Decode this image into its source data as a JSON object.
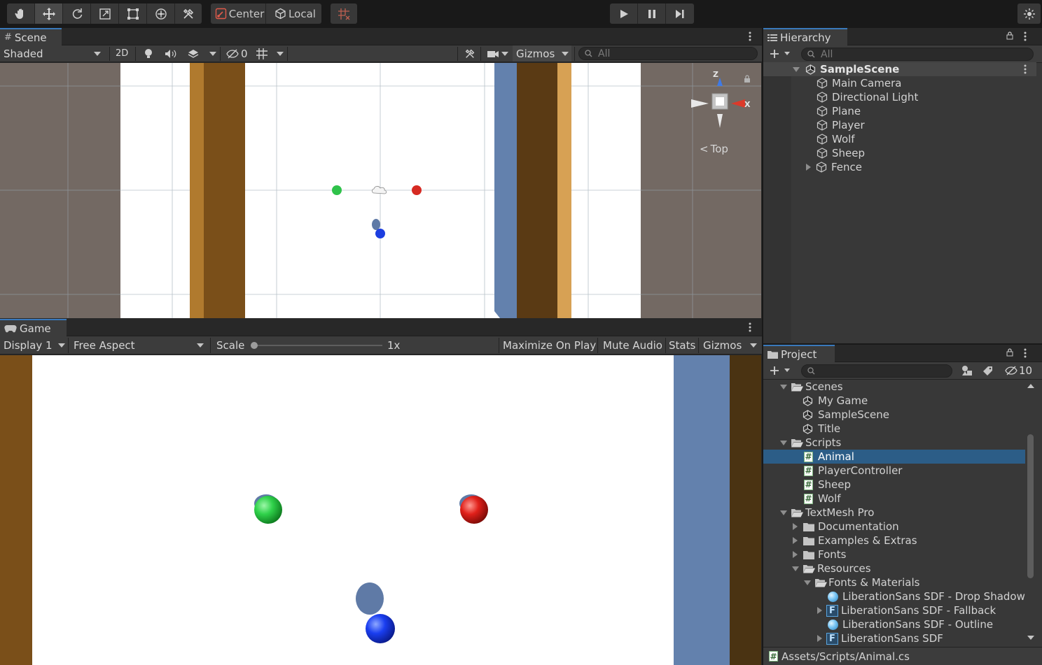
{
  "toolbar": {
    "tools": [
      "hand-tool",
      "move-tool",
      "rotate-tool",
      "scale-tool",
      "rect-tool",
      "transform-tool",
      "custom-tool"
    ],
    "pivot_label": "Center",
    "space_label": "Local"
  },
  "scene": {
    "tab_label": "Scene",
    "shading_mode": "Shaded",
    "toggle_2d": "2D",
    "hidden_count": "0",
    "gizmos_label": "Gizmos",
    "search_placeholder": "All",
    "gizmo_view_label": "Top",
    "axis_z": "Z",
    "axis_x": "X"
  },
  "game": {
    "tab_label": "Game",
    "display": "Display 1",
    "aspect": "Free Aspect",
    "scale_label": "Scale",
    "scale_value": "1x",
    "scale_fraction": 0.0,
    "maximize_label": "Maximize On Play",
    "mute_label": "Mute Audio",
    "stats_label": "Stats",
    "gizmos_label": "Gizmos"
  },
  "hierarchy": {
    "tab_label": "Hierarchy",
    "search_placeholder": "All",
    "scene_name": "SampleScene",
    "objects": [
      "Main Camera",
      "Directional Light",
      "Plane",
      "Player",
      "Wolf",
      "Sheep",
      "Fence"
    ]
  },
  "project": {
    "tab_label": "Project",
    "hidden_packages_count": "10",
    "search_placeholder": "",
    "tree": [
      {
        "label": "Scenes",
        "kind": "folder-open"
      },
      {
        "label": "My Game",
        "kind": "scene"
      },
      {
        "label": "SampleScene",
        "kind": "scene"
      },
      {
        "label": "Title",
        "kind": "scene"
      },
      {
        "label": "Scripts",
        "kind": "folder-open"
      },
      {
        "label": "Animal",
        "kind": "script",
        "selected": true
      },
      {
        "label": "PlayerController",
        "kind": "script"
      },
      {
        "label": "Sheep",
        "kind": "script"
      },
      {
        "label": "Wolf",
        "kind": "script"
      },
      {
        "label": "TextMesh Pro",
        "kind": "folder-open"
      },
      {
        "label": "Documentation",
        "kind": "folder"
      },
      {
        "label": "Examples & Extras",
        "kind": "folder"
      },
      {
        "label": "Fonts",
        "kind": "folder"
      },
      {
        "label": "Resources",
        "kind": "folder-open"
      },
      {
        "label": "Fonts & Materials",
        "kind": "folder-open"
      },
      {
        "label": "LiberationSans SDF - Drop Shadow",
        "kind": "material"
      },
      {
        "label": "LiberationSans SDF - Fallback",
        "kind": "font-asset"
      },
      {
        "label": "LiberationSans SDF - Outline",
        "kind": "material"
      },
      {
        "label": "LiberationSans SDF",
        "kind": "font-asset"
      }
    ],
    "status_path": "Assets/Scripts/Animal.cs"
  },
  "colors": {
    "accent": "#3a79bb",
    "selection": "#2c5d87",
    "play_icon": "#c8c8c8",
    "fence_wood": "#7a4f19",
    "water_blue": "#6381ad"
  }
}
